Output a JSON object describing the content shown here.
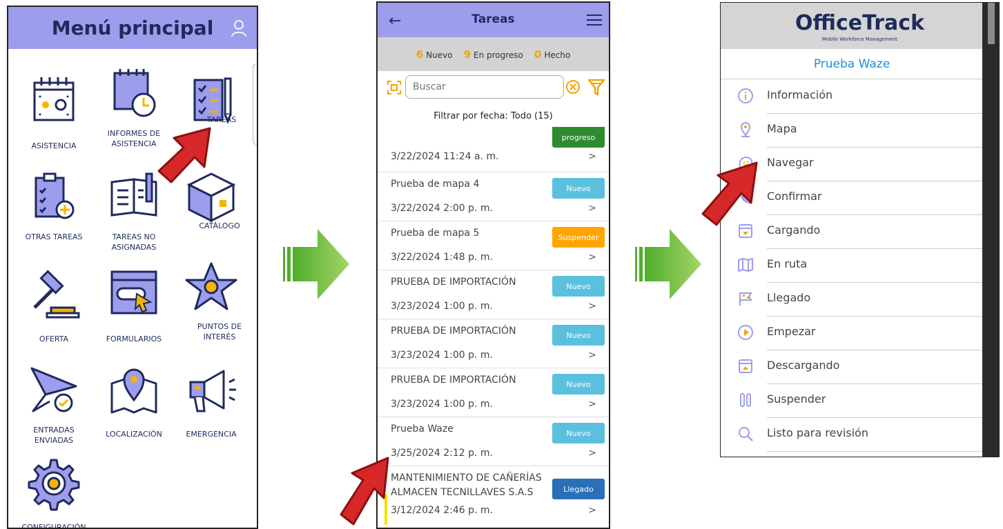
{
  "menu": {
    "title": "Menú principal",
    "tiles": [
      {
        "label": "ASISTENCIA",
        "icon": "calendar-icon"
      },
      {
        "label": "INFORMES DE ASISTENCIA",
        "icon": "calendar-clock-icon"
      },
      {
        "label": "TAREAS",
        "icon": "checklist-icon"
      },
      {
        "label": "OTRAS TAREAS",
        "icon": "clipboard-plus-icon"
      },
      {
        "label": "TAREAS NO ASIGNADAS",
        "icon": "notebook-pen-icon"
      },
      {
        "label": "CATÁLOGO",
        "icon": "box-icon"
      },
      {
        "label": "OFERTA",
        "icon": "gavel-icon"
      },
      {
        "label": "FORMULARIOS",
        "icon": "form-cursor-icon"
      },
      {
        "label": "PUNTOS DE INTERÉS",
        "icon": "star-icon"
      },
      {
        "label": "ENTRADAS ENVIADAS",
        "icon": "send-check-icon"
      },
      {
        "label": "LOCALIZACIÓN",
        "icon": "map-pin-icon"
      },
      {
        "label": "EMERGENCIA",
        "icon": "megaphone-icon"
      },
      {
        "label": "CONFIGURACIÓN",
        "icon": "gear-icon"
      }
    ]
  },
  "tasks": {
    "title": "Tareas",
    "counts": [
      {
        "num": "6",
        "label": "Nuevo"
      },
      {
        "num": "9",
        "label": "En progreso"
      },
      {
        "num": "0",
        "label": "Hecho"
      }
    ],
    "search_placeholder": "Buscar",
    "filter_text": "Filtrar por fecha: Todo (15)",
    "items": [
      {
        "name": "",
        "date": "3/22/2024 11:24 a. m.",
        "status": "progreso",
        "color": "#2e8b2e"
      },
      {
        "name": "Prueba de mapa 4",
        "date": "3/22/2024 2:00 p. m.",
        "status": "Nuevo",
        "color": "#5bc0de"
      },
      {
        "name": "Prueba de mapa 5",
        "date": "3/22/2024 1:48 p. m.",
        "status": "Suspender",
        "color": "#ffa500"
      },
      {
        "name": "PRUEBA DE IMPORTACIÓN",
        "date": "3/23/2024 1:00 p. m.",
        "status": "Nuevo",
        "color": "#5bc0de"
      },
      {
        "name": "PRUEBA DE IMPORTACIÓN",
        "date": "3/23/2024 1:00 p. m.",
        "status": "Nuevo",
        "color": "#5bc0de"
      },
      {
        "name": "PRUEBA DE IMPORTACIÓN",
        "date": "3/23/2024 1:00 p. m.",
        "status": "Nuevo",
        "color": "#5bc0de"
      },
      {
        "name": "Prueba Waze",
        "date": "3/25/2024 2:12 p. m.",
        "status": "Nuevo",
        "color": "#5bc0de"
      },
      {
        "name": "MANTENIMIENTO DE CAÑERÍAS",
        "name2": "ALMACEN TECNILLAVES S.A.S",
        "date": "3/12/2024 2:46 p. m.",
        "status": "Llegado",
        "color": "#2a6fb8"
      }
    ]
  },
  "officetrack": {
    "brand": "OfficeTrack",
    "tagline": "Mobile Workforce Management",
    "project": "Prueba Waze",
    "items": [
      {
        "label": "Información",
        "icon": "info-icon"
      },
      {
        "label": "Mapa",
        "icon": "map-pin-icon"
      },
      {
        "label": "Navegar",
        "icon": "waze-icon"
      },
      {
        "label": "Confirmar",
        "icon": "phone-signal-icon"
      },
      {
        "label": "Cargando",
        "icon": "load-box-icon"
      },
      {
        "label": "En ruta",
        "icon": "map-fold-icon"
      },
      {
        "label": "Llegado",
        "icon": "flag-icon"
      },
      {
        "label": "Empezar",
        "icon": "play-icon"
      },
      {
        "label": "Descargando",
        "icon": "unload-box-icon"
      },
      {
        "label": "Suspender",
        "icon": "pause-icon"
      },
      {
        "label": "Listo para revisión",
        "icon": "magnifier-icon"
      }
    ]
  },
  "colors": {
    "header": "#9d9ded",
    "navy": "#1f2a5c",
    "accent": "#f5a300",
    "pointer": "#d62828",
    "arrow_green": "#7cc242"
  }
}
